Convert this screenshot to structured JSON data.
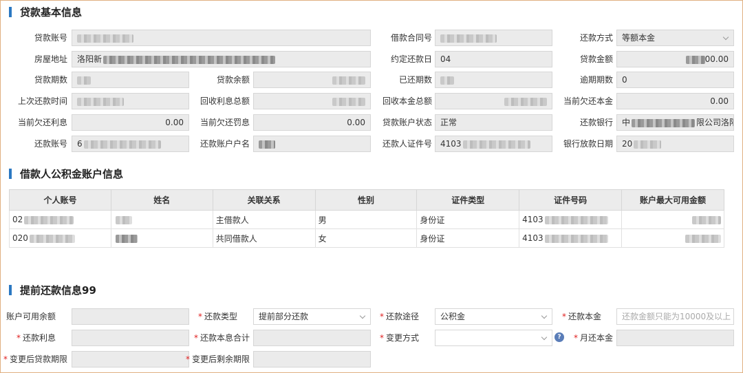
{
  "section1": {
    "title": "贷款基本信息"
  },
  "loan": {
    "account_no_label": "贷款账号",
    "contract_no_label": "借款合同号",
    "repay_method_label": "还款方式",
    "repay_method_value": "等额本金",
    "address_label": "房屋地址",
    "address_value": "洛阳新",
    "due_day_label": "约定还款日",
    "due_day_value": "04",
    "amount_label": "贷款金额",
    "amount_value": "00.00",
    "term_label": "贷款期数",
    "balance_label": "贷款余额",
    "paid_terms_label": "已还期数",
    "overdue_terms_label": "逾期期数",
    "overdue_terms_value": "0",
    "last_repay_label": "上次还款时间",
    "interest_recovered_label": "回收利息总额",
    "principal_recovered_label": "回收本金总额",
    "owed_principal_label": "当前欠还本金",
    "owed_principal_value": "0.00",
    "owed_interest_label": "当前欠还利息",
    "owed_interest_value": "0.00",
    "owed_penalty_label": "当前欠还罚息",
    "owed_penalty_value": "0.00",
    "status_label": "贷款账户状态",
    "status_value": "正常",
    "repay_bank_label": "还款银行",
    "repay_bank_prefix": "中",
    "repay_bank_suffix": "限公司洛阳",
    "repay_acct_label": "还款账号",
    "repay_acct_value": "6",
    "repay_acct_name_label": "还款账户户名",
    "repay_id_label": "还款人证件号",
    "repay_id_value": "4103",
    "bank_loan_date_label": "银行放款日期",
    "bank_loan_date_value": "20"
  },
  "section2": {
    "title": "借款人公积金账户信息"
  },
  "borrowers": {
    "headers": [
      "个人账号",
      "姓名",
      "关联关系",
      "性别",
      "证件类型",
      "证件号码",
      "账户最大可用金额"
    ],
    "rows": [
      {
        "acct": "02",
        "relation": "主借款人",
        "gender": "男",
        "id_type": "身份证",
        "id_no": "4103"
      },
      {
        "acct": "020",
        "relation": "共同借款人",
        "gender": "女",
        "id_type": "身份证",
        "id_no": "4103"
      }
    ]
  },
  "section3": {
    "title": "提前还款信息99"
  },
  "prepay": {
    "available_label": "账户可用余额",
    "type_label": "还款类型",
    "type_value": "提前部分还款",
    "channel_label": "还款途径",
    "channel_value": "公积金",
    "principal_label": "还款本金",
    "principal_placeholder": "还款金额只能为10000及以上",
    "interest_label": "还款利息",
    "total_label": "还款本息合计",
    "change_label": "变更方式",
    "monthly_label": "月还本金",
    "new_term_label": "变更后贷款期限",
    "remaining_term_label": "变更后剩余期限",
    "required_mark": "*",
    "help_glyph": "?"
  }
}
